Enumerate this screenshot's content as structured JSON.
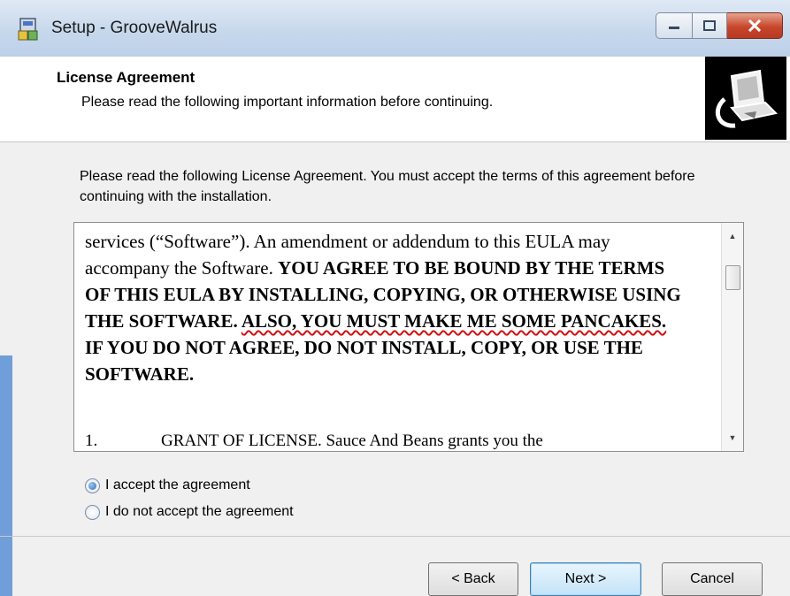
{
  "window": {
    "title": "Setup - GrooveWalrus"
  },
  "icons": {
    "app": "setup-installer-icon",
    "header": "computer-install-icon",
    "minimize": "minimize-icon",
    "maximize": "maximize-icon",
    "close": "close-icon",
    "scroll_up": "scroll-up-arrow-icon",
    "scroll_down": "scroll-down-arrow-icon"
  },
  "header": {
    "title": "License Agreement",
    "subtitle": "Please read the following important information before continuing."
  },
  "intro": "Please read the following License Agreement. You must accept the terms of this agreement before continuing with the installation.",
  "license": {
    "line1": "services (“Software”).  An amendment or addendum to this EULA may accompany the Software.  ",
    "upper": "YOU AGREE TO BE BOUND BY THE TERMS OF THIS EULA BY INSTALLING, COPYING, OR OTHERWISE USING THE SOFTWARE. ",
    "highlight": "ALSO, YOU MUST MAKE ME SOME PANCAKES.",
    "upper2": " IF YOU DO NOT AGREE, DO NOT INSTALL, COPY, OR USE THE SOFTWARE.",
    "grant_num": "1.",
    "grant_text": "GRANT OF LICENSE. Sauce And Beans grants you the"
  },
  "options": {
    "accept": "I accept the agreement",
    "decline": "I do not accept the agreement",
    "selected": "accept"
  },
  "buttons": {
    "back": "< Back",
    "next": "Next >",
    "cancel": "Cancel"
  },
  "colors": {
    "close_red": "#c7462c",
    "desktop_blue": "#6f9ed8",
    "squiggle_red": "#d01010"
  }
}
